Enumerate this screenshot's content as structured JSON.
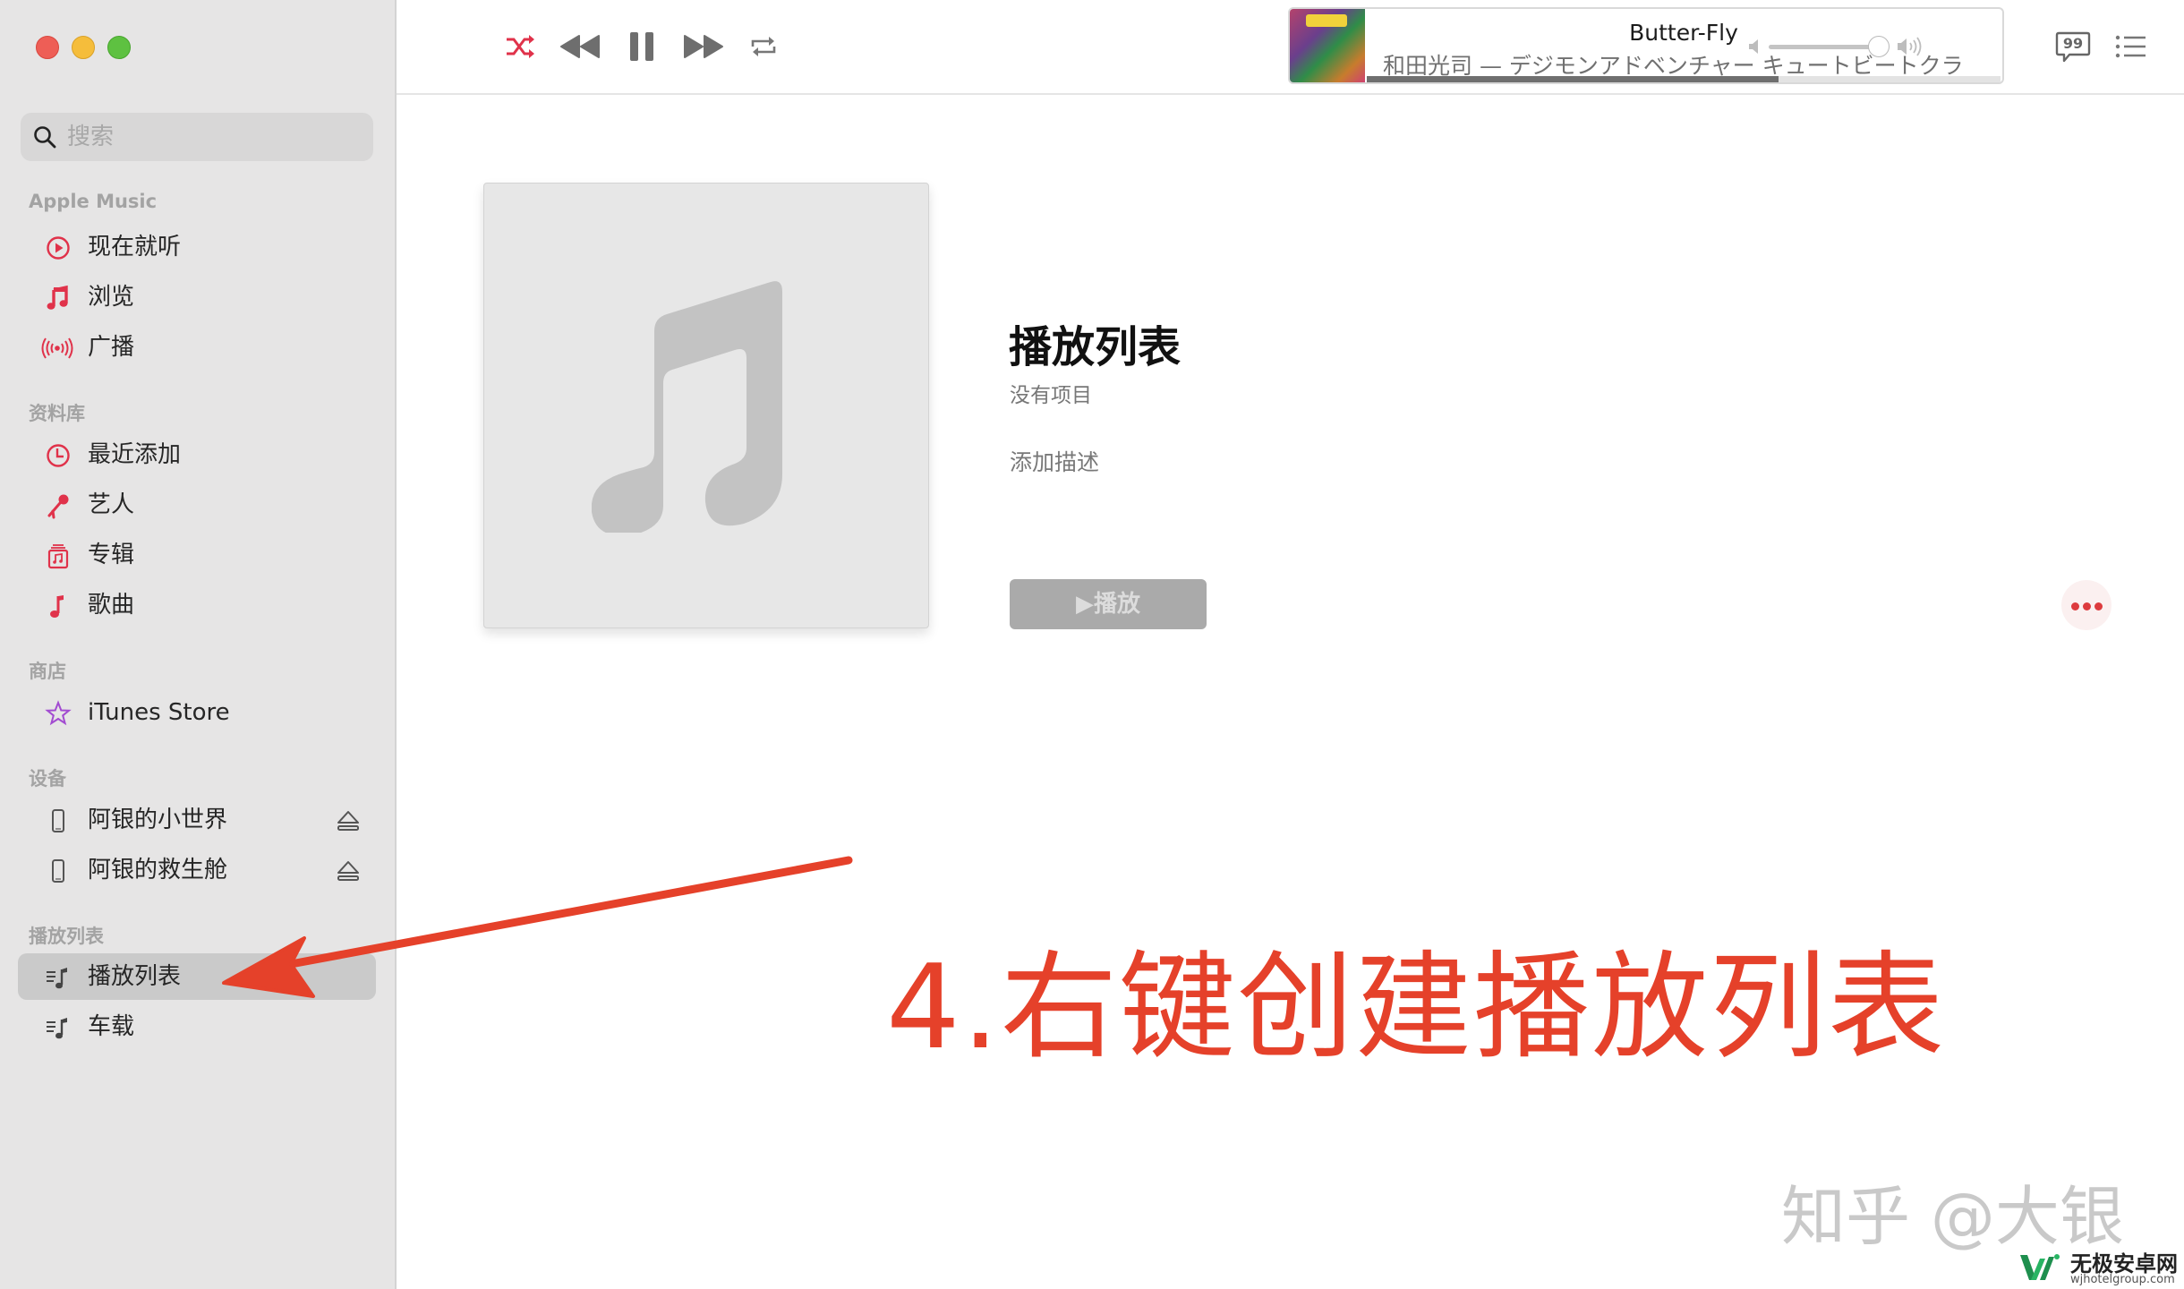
{
  "window": {
    "controls": [
      "close",
      "minimize",
      "maximize"
    ]
  },
  "search": {
    "placeholder": "搜索",
    "value": ""
  },
  "sidebar": {
    "sections": [
      {
        "title": "Apple Music",
        "items": [
          {
            "label": "现在就听",
            "icon": "play-circle-icon"
          },
          {
            "label": "浏览",
            "icon": "music-note-icon"
          },
          {
            "label": "广播",
            "icon": "radio-broadcast-icon"
          }
        ]
      },
      {
        "title": "资料库",
        "items": [
          {
            "label": "最近添加",
            "icon": "clock-icon"
          },
          {
            "label": "艺人",
            "icon": "microphone-icon"
          },
          {
            "label": "专辑",
            "icon": "album-stack-icon"
          },
          {
            "label": "歌曲",
            "icon": "single-note-icon"
          }
        ]
      },
      {
        "title": "商店",
        "items": [
          {
            "label": "iTunes Store",
            "icon": "star-icon"
          }
        ]
      },
      {
        "title": "设备",
        "items": [
          {
            "label": "阿银的小世界",
            "icon": "iphone-icon",
            "eject": true
          },
          {
            "label": "阿银的救生舱",
            "icon": "iphone-icon",
            "eject": true
          }
        ]
      },
      {
        "title": "播放列表",
        "items": [
          {
            "label": "播放列表",
            "icon": "playlist-icon",
            "selected": true
          },
          {
            "label": "车载",
            "icon": "playlist-icon"
          }
        ]
      }
    ]
  },
  "toolbar": {
    "controls": [
      "shuffle-icon",
      "previous-icon",
      "pause-icon",
      "next-icon",
      "repeat-icon"
    ],
    "now_playing": {
      "title": "Butter-Fly",
      "subtitle": "和田光司 — デジモンアドベンチャー キュートビートクラ",
      "progress_fraction": 0.65
    },
    "volume_fraction": 0.92
  },
  "playlist": {
    "title": "播放列表",
    "count_text": "没有项目",
    "description_placeholder": "添加描述",
    "play_label": "播放",
    "play_glyph": "▶"
  },
  "colors": {
    "accent": "#dd3b3e",
    "annotation": "#e5412a",
    "itunes_star": "#a24bd1"
  },
  "annotation": {
    "text": "4.右键创建播放列表"
  },
  "watermark": {
    "text": "知乎 @大银"
  },
  "site_logo": {
    "name": "无极安卓网",
    "url_text": "wjhotelgroup.com"
  }
}
